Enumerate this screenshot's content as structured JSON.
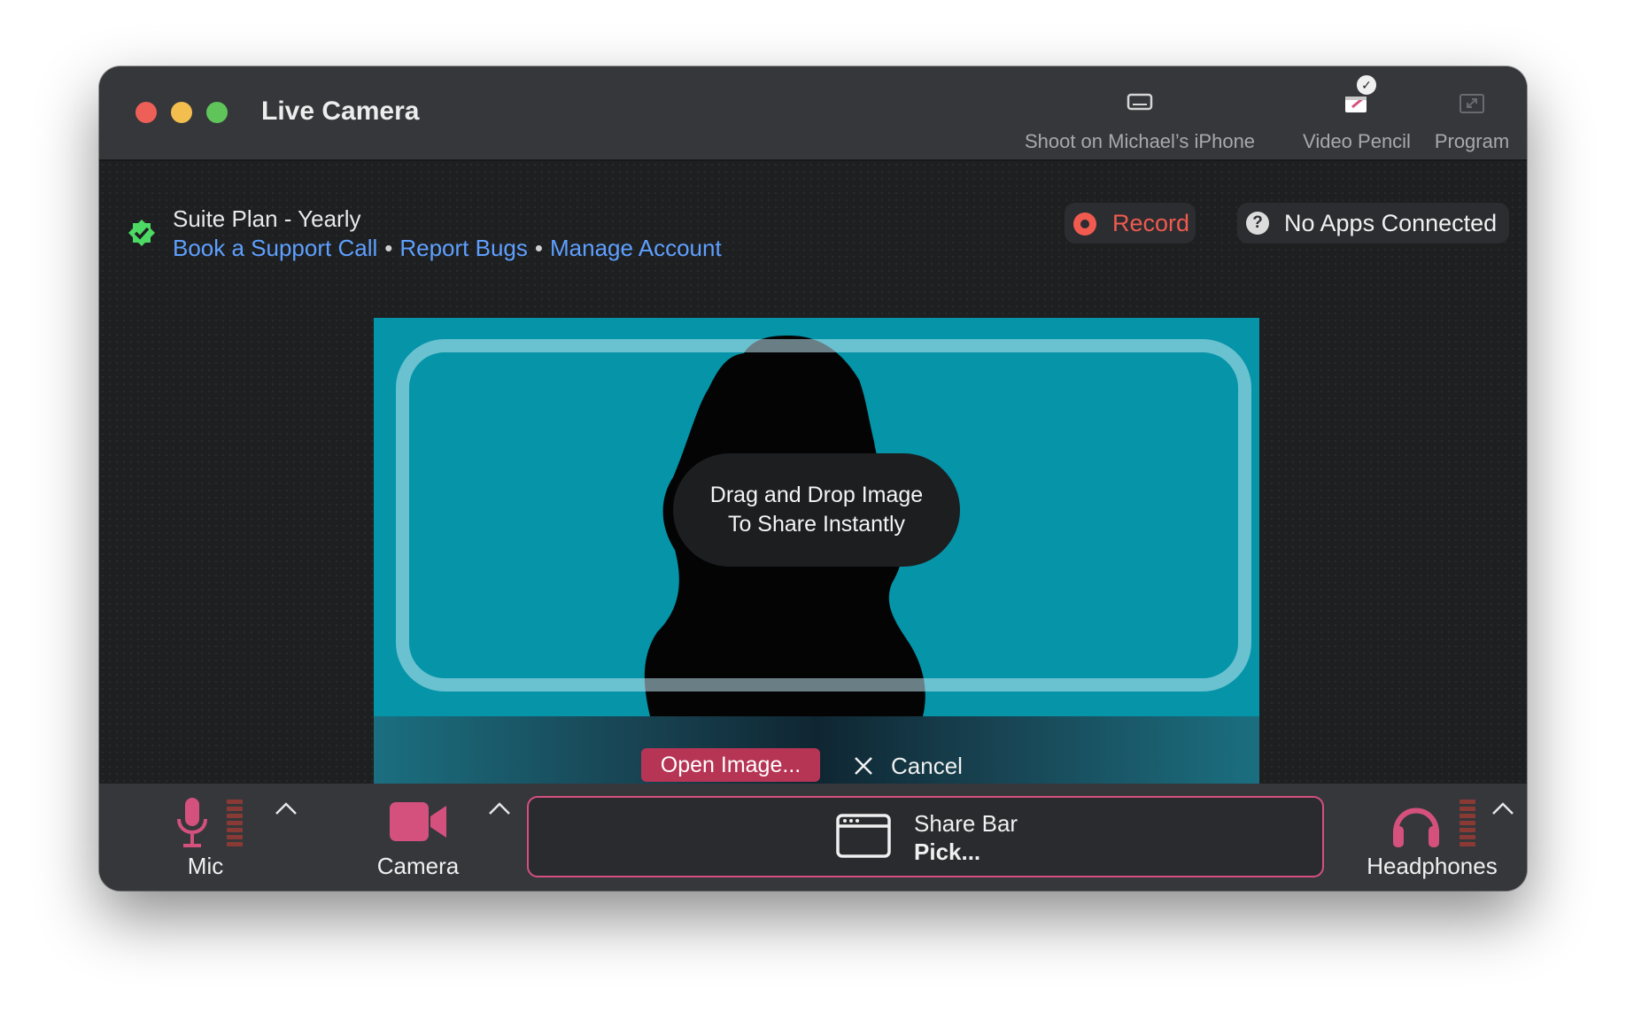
{
  "window": {
    "title": "Live Camera"
  },
  "toolbar": {
    "shoot_label": "Shoot on Michael’s iPhone",
    "pencil_label": "Video Pencil",
    "program_label": "Program",
    "icons": {
      "shoot": "display-icon",
      "pencil": "pencil-window-icon",
      "program": "expand-icon",
      "badge": "checkmark-badge-icon"
    }
  },
  "account": {
    "plan": "Suite Plan - Yearly",
    "links": [
      "Book a Support Call",
      "Report Bugs",
      "Manage Account"
    ],
    "separator": "•"
  },
  "status": {
    "record_label": "Record",
    "apps_label": "No Apps Connected",
    "apps_icon_text": "?"
  },
  "stage": {
    "drop_line1": "Drag and Drop Image",
    "drop_line2": "To Share Instantly",
    "open_label": "Open Image...",
    "cancel_label": "Cancel"
  },
  "controls": {
    "mic_label": "Mic",
    "camera_label": "Camera",
    "share_title": "Share Bar",
    "share_sub": "Pick...",
    "headphones_label": "Headphones"
  },
  "colors": {
    "accent": "#d5517d",
    "link": "#5ea0ff",
    "record": "#f05a4f",
    "stage_bg": "#0594a8",
    "plan_check": "#4cd964"
  }
}
